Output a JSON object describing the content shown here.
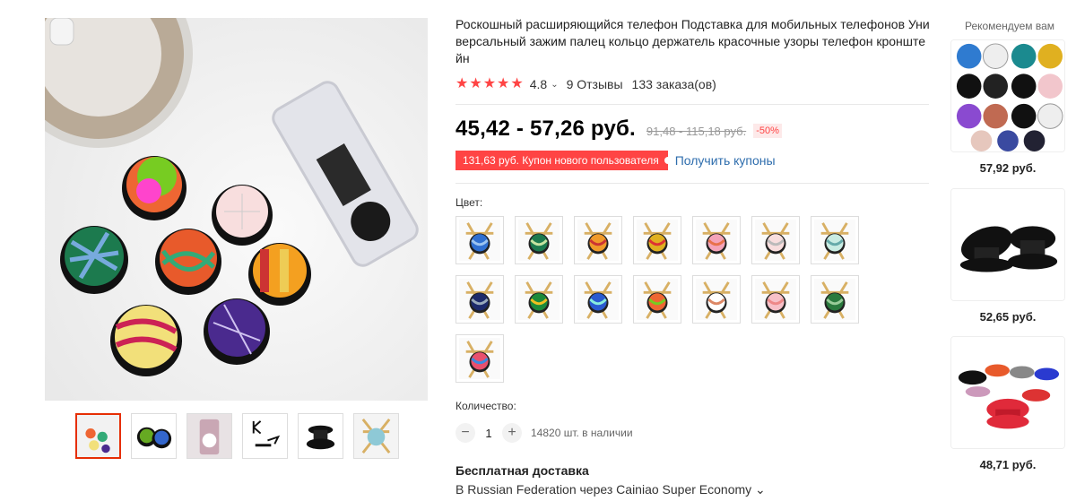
{
  "product": {
    "title": "Роскошный расширяющийся телефон Подставка для мобильных телефонов Универсальный зажим палец кольцо держатель красочные узоры телефон кронштейн",
    "rating": "4.8",
    "reviews": "9 Отзывы",
    "orders": "133 заказа(ов)",
    "price": "45,42 - 57,26 руб.",
    "old_price": "91,48 - 115,18 руб.",
    "discount": "-50%",
    "coupon": "131,63 руб. Купон нового пользователя",
    "get_coupons": "Получить купоны",
    "color_label": "Цвет:",
    "quantity_label": "Количество:",
    "quantity": "1",
    "stock": "14820 шт. в наличии",
    "shipping_title": "Бесплатная доставка",
    "shipping_sub": "В Russian Federation через Cainiao Super Economy ⌄"
  },
  "colors": {
    "accent": "#ff4747",
    "link": "#2e6dad"
  },
  "swatch_patterns": [
    "blue-marble",
    "green-stripes",
    "orange-stripes",
    "rainbow-stripes",
    "wave-pink",
    "white-grid",
    "mint-marble",
    "navy-geo",
    "green-target",
    "blue-geo",
    "checker",
    "chevron",
    "pink-grid",
    "leaf",
    "galaxy"
  ],
  "icons": {
    "star": "star-icon",
    "minus": "minus-icon",
    "plus": "plus-icon"
  },
  "recommend": {
    "title": "Рекомендуем вам",
    "items": [
      {
        "price": "57,92 руб."
      },
      {
        "price": "52,65 руб."
      },
      {
        "price": "48,71 руб."
      }
    ]
  }
}
